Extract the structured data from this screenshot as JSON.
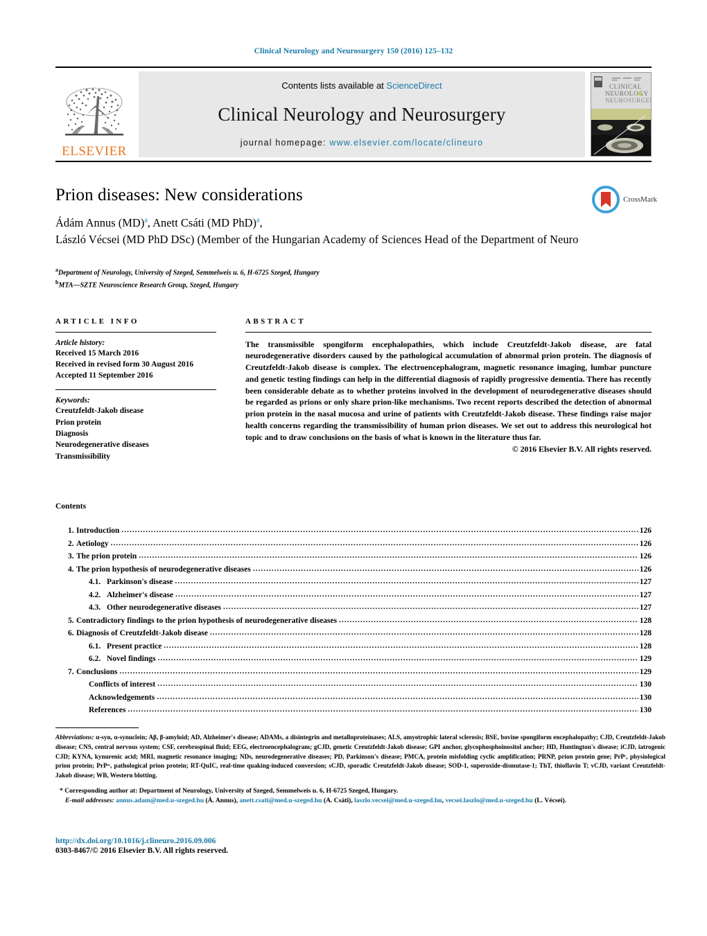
{
  "citation": "Clinical Neurology and Neurosurgery 150 (2016) 125–132",
  "masthead": {
    "contents_prefix": "Contents lists available at ",
    "sciencedirect": "ScienceDirect",
    "journal_title": "Clinical Neurology and Neurosurgery",
    "homepage_label": "journal homepage:",
    "homepage_url": "www.elsevier.com/locate/clineuro",
    "publisher": "ELSEVIER",
    "cover_title_line1": "CLINICAL",
    "cover_title_line2": "NEUROLOGY",
    "cover_title_line3": "NEUROSURGERY"
  },
  "article": {
    "title": "Prion diseases: New considerations",
    "author_line_1": "Ádám Annus (MD)",
    "author_line_1_sup": "a",
    "author_line_1b": ", Anett Csáti (MD PhD)",
    "author_line_1b_sup": "a",
    "author_line_1c": ",",
    "author_line_2": "László Vécsei (MD PhD DSc) (Member of the Hungarian Academy of Sciences Head of the Department of Neuro",
    "crossmark_label": "CrossMark",
    "affiliation_a_sup": "a",
    "affiliation_a": "Department of Neurology, University of Szeged, Semmelweis u. 6, H-6725 Szeged, Hungary",
    "affiliation_b_sup": "b",
    "affiliation_b": "MTA—SZTE Neuroscience Research Group, Szeged, Hungary"
  },
  "article_info": {
    "heading": "ARTICLE INFO",
    "history_label": "Article history:",
    "history": [
      "Received 15 March 2016",
      "Received in revised form 30 August 2016",
      "Accepted 11 September 2016"
    ],
    "keywords_label": "Keywords:",
    "keywords": [
      "Creutzfeldt-Jakob disease",
      "Prion protein",
      "Diagnosis",
      "Neurodegenerative diseases",
      "Transmissibility"
    ]
  },
  "abstract": {
    "heading": "ABSTRACT",
    "body": "The transmissible spongiform encephalopathies, which include Creutzfeldt-Jakob disease, are fatal neurodegenerative disorders caused by the pathological accumulation of abnormal prion protein. The diagnosis of Creutzfeldt-Jakob disease is complex. The electroencephalogram, magnetic resonance imaging, lumbar puncture and genetic testing findings can help in the differential diagnosis of rapidly progressive dementia. There has recently been considerable debate as to whether proteins involved in the development of neurodegenerative diseases should be regarded as prions or only share prion-like mechanisms. Two recent reports described the detection of abnormal prion protein in the nasal mucosa and urine of patients with Creutzfeldt-Jakob disease. These findings raise major health concerns regarding the transmissibility of human prion diseases. We set out to address this neurological hot topic and to draw conclusions on the basis of what is known in the literature thus far.",
    "copyright": "© 2016 Elsevier B.V. All rights reserved."
  },
  "contents": {
    "heading": "Contents",
    "entries": [
      {
        "num": "1.",
        "label": "Introduction",
        "page": "126",
        "level": "1"
      },
      {
        "num": "2.",
        "label": "Aetiology",
        "page": "126",
        "level": "1"
      },
      {
        "num": "3.",
        "label": "The prion protein",
        "page": "126",
        "level": "1"
      },
      {
        "num": "4.",
        "label": "The prion hypothesis of neurodegenerative diseases",
        "page": "126",
        "level": "1"
      },
      {
        "num": "4.1.",
        "label": "Parkinson's disease",
        "page": "127",
        "level": "2"
      },
      {
        "num": "4.2.",
        "label": "Alzheimer's disease",
        "page": "127",
        "level": "2"
      },
      {
        "num": "4.3.",
        "label": "Other neurodegenerative diseases",
        "page": "127",
        "level": "2"
      },
      {
        "num": "5.",
        "label": "Contradictory findings to the prion hypothesis of neurodegenerative diseases",
        "page": "128",
        "level": "1"
      },
      {
        "num": "6.",
        "label": "Diagnosis of Creutzfeldt-Jakob disease",
        "page": "128",
        "level": "1"
      },
      {
        "num": "6.1.",
        "label": "Present practice",
        "page": "128",
        "level": "2"
      },
      {
        "num": "6.2.",
        "label": "Novel findings",
        "page": "129",
        "level": "2"
      },
      {
        "num": "7.",
        "label": "Conclusions",
        "page": "129",
        "level": "1"
      },
      {
        "num": "",
        "label": "Conflicts of interest",
        "page": "130",
        "level": "3"
      },
      {
        "num": "",
        "label": "Acknowledgements",
        "page": "130",
        "level": "3"
      },
      {
        "num": "",
        "label": "References",
        "page": "130",
        "level": "3"
      }
    ]
  },
  "footnotes": {
    "abbrev_label": "Abbreviations:",
    "abbrev_text": "α-syn, α-synuclein; Aβ, β-amyloid; AD, Alzheimer's disease; ADAMs, a disintegrin and metalloproteinases; ALS, amyotrophic lateral sclerosis; BSE, bovine spongiform encephalopathy; CJD, Creutzfeldt-Jakob disease; CNS, central nervous system; CSF, cerebrospinal fluid; EEG, electroencephalogram; gCJD, genetic Creutzfeldt-Jakob disease; GPI anchor, glycophosphoinositol anchor; HD, Huntington's disease; iCJD, iatrogenic CJD; KYNA, kynurenic acid; MRI, magnetic resonance imaging; NDs, neurodegenerative diseases; PD, Parkinson's disease; PMCA, protein misfolding cyclic amplification; PRNP, prion protein gene; PrPᶜ, physiological prion protein; PrPˢᶜ, pathological prion protein; RT-QuIC, real-time quaking-induced conversion; sCJD, sporadic Creutzfeldt-Jakob disease; SOD-1, superoxide-dismutase-1; ThT, thioflavin T; vCJD, variant Creutzfeldt-Jakob disease; WB, Western blotting.",
    "corresponding": "* Corresponding author at: Department of Neurology, University of Szeged, Semmelweis u. 6, H-6725 Szeged, Hungary.",
    "email_label": "E-mail addresses:",
    "emails": [
      {
        "address": "annus.adam@med.u-szeged.hu",
        "person": " (Á. Annus), "
      },
      {
        "address": "anett.csati@med.u-szeged.hu",
        "person": " (A. Csáti), "
      },
      {
        "address": "laszlo.vecsei@med.u-szeged.hu",
        "person": ", "
      },
      {
        "address": "vecsei.laszlo@med.u-szeged.hu",
        "person": ""
      }
    ],
    "email_tail": "(L. Vécsei)."
  },
  "footer": {
    "doi": "http://dx.doi.org/10.1016/j.clineuro.2016.09.006",
    "issn": "0303-8467/© 2016 Elsevier B.V. All rights reserved."
  },
  "colors": {
    "link": "#1a7aa8",
    "elsevier_orange": "#E87722",
    "masthead_bg": "#e8e8e8"
  }
}
